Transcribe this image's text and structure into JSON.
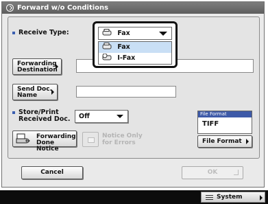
{
  "window": {
    "title": "Forward w/o Conditions"
  },
  "receive_type": {
    "label": "Receive Type:",
    "selected": "Fax",
    "options": [
      "Fax",
      "I-Fax"
    ],
    "highlighted_option": "Fax"
  },
  "forwarding_destination": {
    "button_label_1": "Forwarding",
    "button_label_2": "Destination",
    "value": ""
  },
  "send_doc_name": {
    "button_label_1": "Send Doc.",
    "button_label_2": "Name",
    "value": ""
  },
  "store_print": {
    "label_1": "Store/Print",
    "label_2": "Received Doc.",
    "selected": "Off"
  },
  "file_format": {
    "header": "File Format",
    "value": "TIFF",
    "button_label": "File Format"
  },
  "forwarding_done_notice": {
    "label_1": "Forwarding",
    "label_2": "Done Notice"
  },
  "notice_only_errors": {
    "label_1": "Notice Only",
    "label_2": "for Errors"
  },
  "footer": {
    "cancel_label": "Cancel",
    "ok_label": "OK"
  },
  "bottom_bar": {
    "system_monitor_label": "System Monitor"
  },
  "colors": {
    "title_bar": "#6b6b6b",
    "accent_blue": "#3e5aa8",
    "highlight": "#c9dff5"
  },
  "icons": {
    "title": "circle-arrow-icon",
    "fax": "fax-icon",
    "ifax": "ifax-icon",
    "notice": "notice-printer-icon",
    "system_monitor": "system-monitor-icon"
  }
}
